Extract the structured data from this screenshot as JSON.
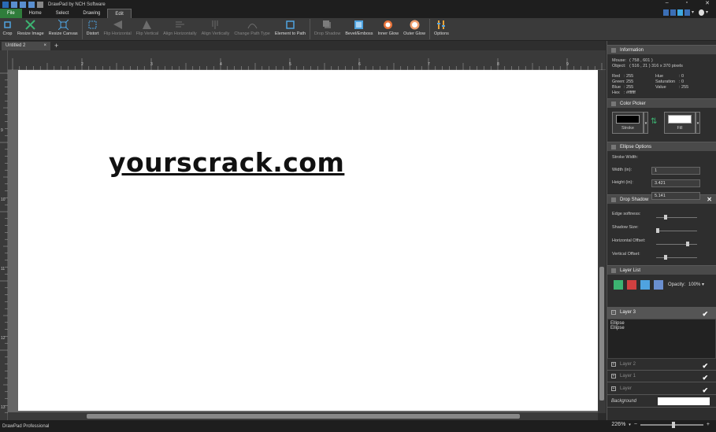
{
  "window": {
    "title": "DrawPad by NCH Software"
  },
  "menu": {
    "tabs": [
      "File",
      "Home",
      "Select",
      "Drawing",
      "Edit"
    ]
  },
  "toolbar": {
    "tools": [
      {
        "label": "Crop",
        "enabled": true
      },
      {
        "label": "Resize Image",
        "enabled": true
      },
      {
        "label": "Resize Canvas",
        "enabled": true
      },
      {
        "label": "Distort",
        "enabled": true
      },
      {
        "label": "Flip Horizontal",
        "enabled": false
      },
      {
        "label": "Flip Vertical",
        "enabled": false
      },
      {
        "label": "Align Horizontally",
        "enabled": false
      },
      {
        "label": "Align Vertically",
        "enabled": false
      },
      {
        "label": "Change Path Type",
        "enabled": false
      },
      {
        "label": "Element to Path",
        "enabled": true
      },
      {
        "label": "Drop Shadow",
        "enabled": false
      },
      {
        "label": "Bevel/Emboss",
        "enabled": true
      },
      {
        "label": "Inner Glow",
        "enabled": true
      },
      {
        "label": "Outer Glow",
        "enabled": true
      },
      {
        "label": "Options",
        "enabled": true
      }
    ]
  },
  "document": {
    "tab": "Untitled 2",
    "close": "×",
    "add": "+"
  },
  "ruler": {
    "h": [
      "2",
      "3",
      "4",
      "5",
      "6",
      "7",
      "8",
      "9"
    ],
    "v": [
      "9",
      "10",
      "11",
      "12",
      "13"
    ]
  },
  "canvas": {
    "text": "yourscrack.com"
  },
  "status": {
    "text": "DrawPad Professional",
    "zoom": "226%"
  },
  "info": {
    "title": "Information",
    "mouse_label": "Mouse:",
    "mouse_value": "( 758 , 601 )",
    "object_label": "Object:",
    "object_value": "( 516 , 21 ) 316 x 370 pixels",
    "rows": [
      [
        "Red",
        ": 255",
        "Hue",
        ": 0"
      ],
      [
        "Green",
        ": 255",
        "Saturation",
        ": 0"
      ],
      [
        "Blue",
        ": 255",
        "Value",
        ": 255"
      ],
      [
        "Hex",
        ": #ffffff",
        "",
        ""
      ]
    ]
  },
  "color_picker": {
    "title": "Color Picker",
    "stroke": "Stroke",
    "fill": "Fill"
  },
  "ellipse": {
    "title": "Ellipse Options",
    "stroke_width_label": "Stroke Width:",
    "stroke_width": "1",
    "width_label": "Width (in):",
    "width": "3.421",
    "height_label": "Height (in):",
    "height": "5.141"
  },
  "drop_shadow": {
    "title": "Drop Shadow",
    "sliders": [
      {
        "label": "Edge softness:",
        "value": 0.2
      },
      {
        "label": "Shadow Size:",
        "value": 0.0
      },
      {
        "label": "Horizontal Offset:",
        "value": 0.8
      },
      {
        "label": "Vertical Offset:",
        "value": 0.2
      }
    ]
  },
  "layers": {
    "title": "Layer List",
    "opacity_label": "Opacity:",
    "opacity": "100%",
    "active": "Layer 3",
    "items_in_active": [
      "Ellipse",
      "Ellipse"
    ],
    "others": [
      "Layer 2",
      "Layer 1",
      "Layer"
    ],
    "background": "Background"
  },
  "colors": {
    "accent": "#2f7d3b",
    "stroke": "#000000",
    "fill": "#ffffff"
  }
}
